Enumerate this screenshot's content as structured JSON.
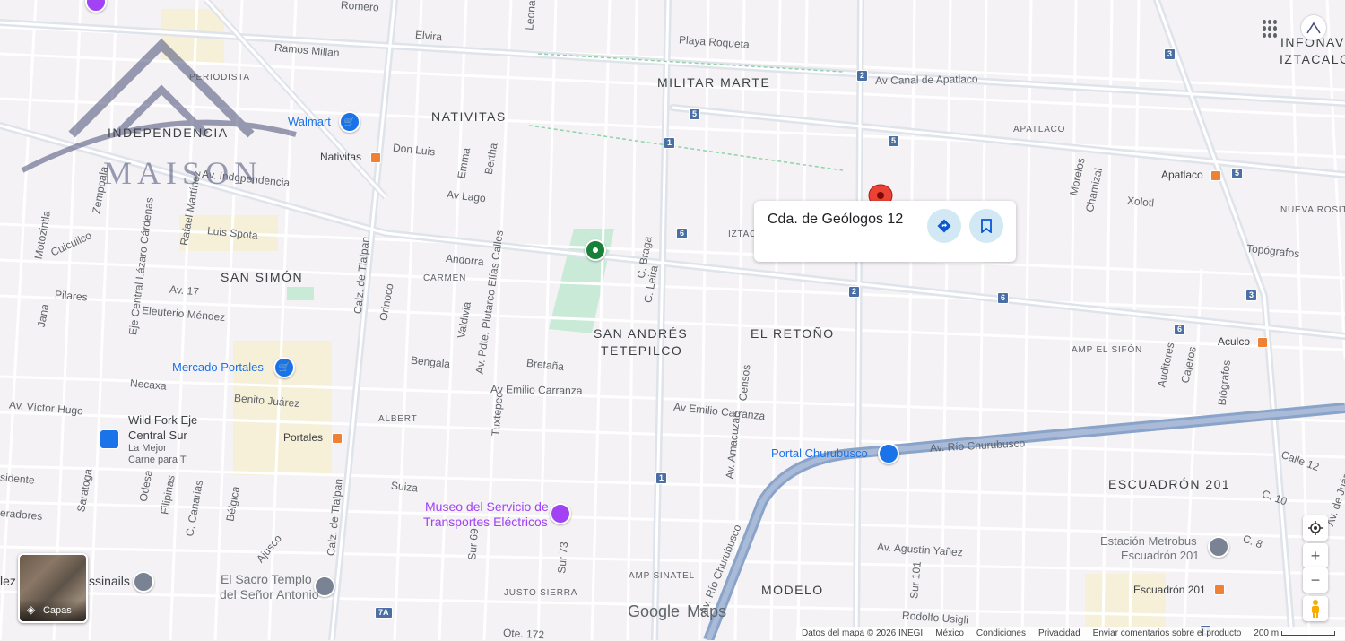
{
  "place_card": {
    "title": "Cda. de Geólogos 12",
    "directions_icon": "directions-icon",
    "save_icon": "bookmark-icon"
  },
  "neighborhoods": {
    "militar_marte": "MILITAR MARTE",
    "nativitas": "NATIVITAS",
    "independencia": "INDEPENDENCIA",
    "san_simon": "SAN SIMÓN",
    "san_andres_1": "SAN ANDRÉS",
    "san_andres_2": "TETEPILCO",
    "el_retono": "EL RETOÑO",
    "escuadron": "ESCUADRÓN 201",
    "modelo": "MODELO",
    "infonav": "INFONAV",
    "iztacalco": "IZTACALC",
    "apatlaco": "APATLACO",
    "periodista": "PERIODISTA",
    "carmen": "CARMEN",
    "albert": "ALBERT",
    "amp_sinatel": "AMP SINATEL",
    "justo_sierra": "JUSTO SIERRA",
    "amp_el_sifon": "AMP EL SIFÓN",
    "nueva_rosita": "NUEVA ROSIT",
    "iztac": "IZTAC"
  },
  "streets": {
    "romero": "Romero",
    "ramos_millan": "Ramos Millan",
    "elvira": "Elvira",
    "playa_roqueta": "Playa Roqueta",
    "canal_apatlaco": "Av Canal de Apatlaco",
    "av_independencia": "Av. Independencia",
    "don_luis": "Don Luis",
    "emma": "Emma",
    "bertha": "Bertha",
    "av_lago": "Av Lago",
    "luis_spota": "Luis Spota",
    "cuicuilco": "Cuicuilco",
    "motozintla": "Motozintla",
    "zempoala": "Zempoala",
    "rafael_martinez": "Rafael Martínez",
    "eje_central": "Eje Central Lázaro Cárdenas",
    "av17": "Av. 17",
    "pilares": "Pilares",
    "eleuterio": "Eleuterio Méndez",
    "jana": "Jana",
    "calz_tlalpan": "Calz. de Tlalpan",
    "orinoco": "Orinoco",
    "andorra": "Andorra",
    "valdivia": "Valdivia",
    "plutarco": "Av. Pdte. Plutarco Elías Calles",
    "bengala": "Bengala",
    "bretana": "Bretaña",
    "braga": "C. Braga",
    "leira": "C. Leira",
    "emilio1": "Av Emilio Carranza",
    "emilio2": "Av Emilio Carranza",
    "necaxa": "Necaxa",
    "benito": "Benito Juárez",
    "victor_hugo": "Av. Víctor Hugo",
    "tuxtepec": "Tuxtepec",
    "suiza": "Suiza",
    "odesa": "Odesa",
    "filipinas": "Filipinas",
    "canarias": "C. Canarias",
    "belgica": "Bélgica",
    "ajusco": "Ajusco",
    "saratoga": "Saratoga",
    "sur69": "Sur 69",
    "sur73": "Sur 73",
    "rio_churubusco": "Av. Río Churubusco",
    "rio_churubusco2": "Av. Río Churubusco",
    "agustin": "Av. Agustín Yañez",
    "rodolfo": "Rodolfo Usigli",
    "ote172": "Ote. 172",
    "censos": "Censos",
    "amacuzac": "Av. Amacuzac",
    "morelos": "Morelos",
    "chamizal": "Chamizal",
    "xolotl": "Xolotl",
    "topografos": "Topógrafos",
    "auditores": "Auditores",
    "cajeros": "Cajeros",
    "biografos": "Biógrafos",
    "calle12": "Calle 12",
    "c10": "C. 10",
    "c8": "C. 8",
    "av_juarez": "Av. de Juárez",
    "sur101": "Sur 101",
    "sidente": "sidente",
    "eradores": "eradores",
    "leon": "Leona"
  },
  "pois": {
    "walmart": "Walmart",
    "nativitas_metro": "Nativitas",
    "mercado_portales": "Mercado Portales",
    "wildfork1": "Wild Fork Eje",
    "wildfork2": "Central Sur",
    "wildfork3": "La Mejor",
    "wildfork4": "Carne para Ti",
    "portales": "Portales",
    "museo1": "Museo del Servicio de",
    "museo2": "Transportes Eléctricos",
    "sacro1": "El Sacro Templo",
    "sacro2": "del Señor Antonio",
    "essinails": "ssinails",
    "portal_churubusco": "Portal Churubusco",
    "apatlaco_metro": "Apatlaco",
    "aculco": "Aculco",
    "estacion1": "Estación Metrobus",
    "estacion2": "Escuadrón 201",
    "escuadron_metro": "Escuadrón 201",
    "lez": "lez"
  },
  "shields": [
    "5",
    "1",
    "2",
    "5",
    "6",
    "6",
    "2",
    "6",
    "3",
    "3",
    "5",
    "6",
    "1",
    "7A",
    "1"
  ],
  "watermark": {
    "brand": "MAISON"
  },
  "controls": {
    "layers_label": "Capas",
    "zoom_in": "+",
    "zoom_out": "−",
    "mylocation_icon": "my-location-icon",
    "pegman_icon": "pegman-icon",
    "apps_icon": "apps-grid-icon"
  },
  "logo": {
    "google": "Google",
    "maps": "Maps"
  },
  "footer": {
    "data": "Datos del mapa © 2026 INEGI",
    "country": "México",
    "terms": "Condiciones",
    "privacy": "Privacidad",
    "feedback": "Enviar comentarios sobre el producto",
    "scale": "200 m"
  }
}
